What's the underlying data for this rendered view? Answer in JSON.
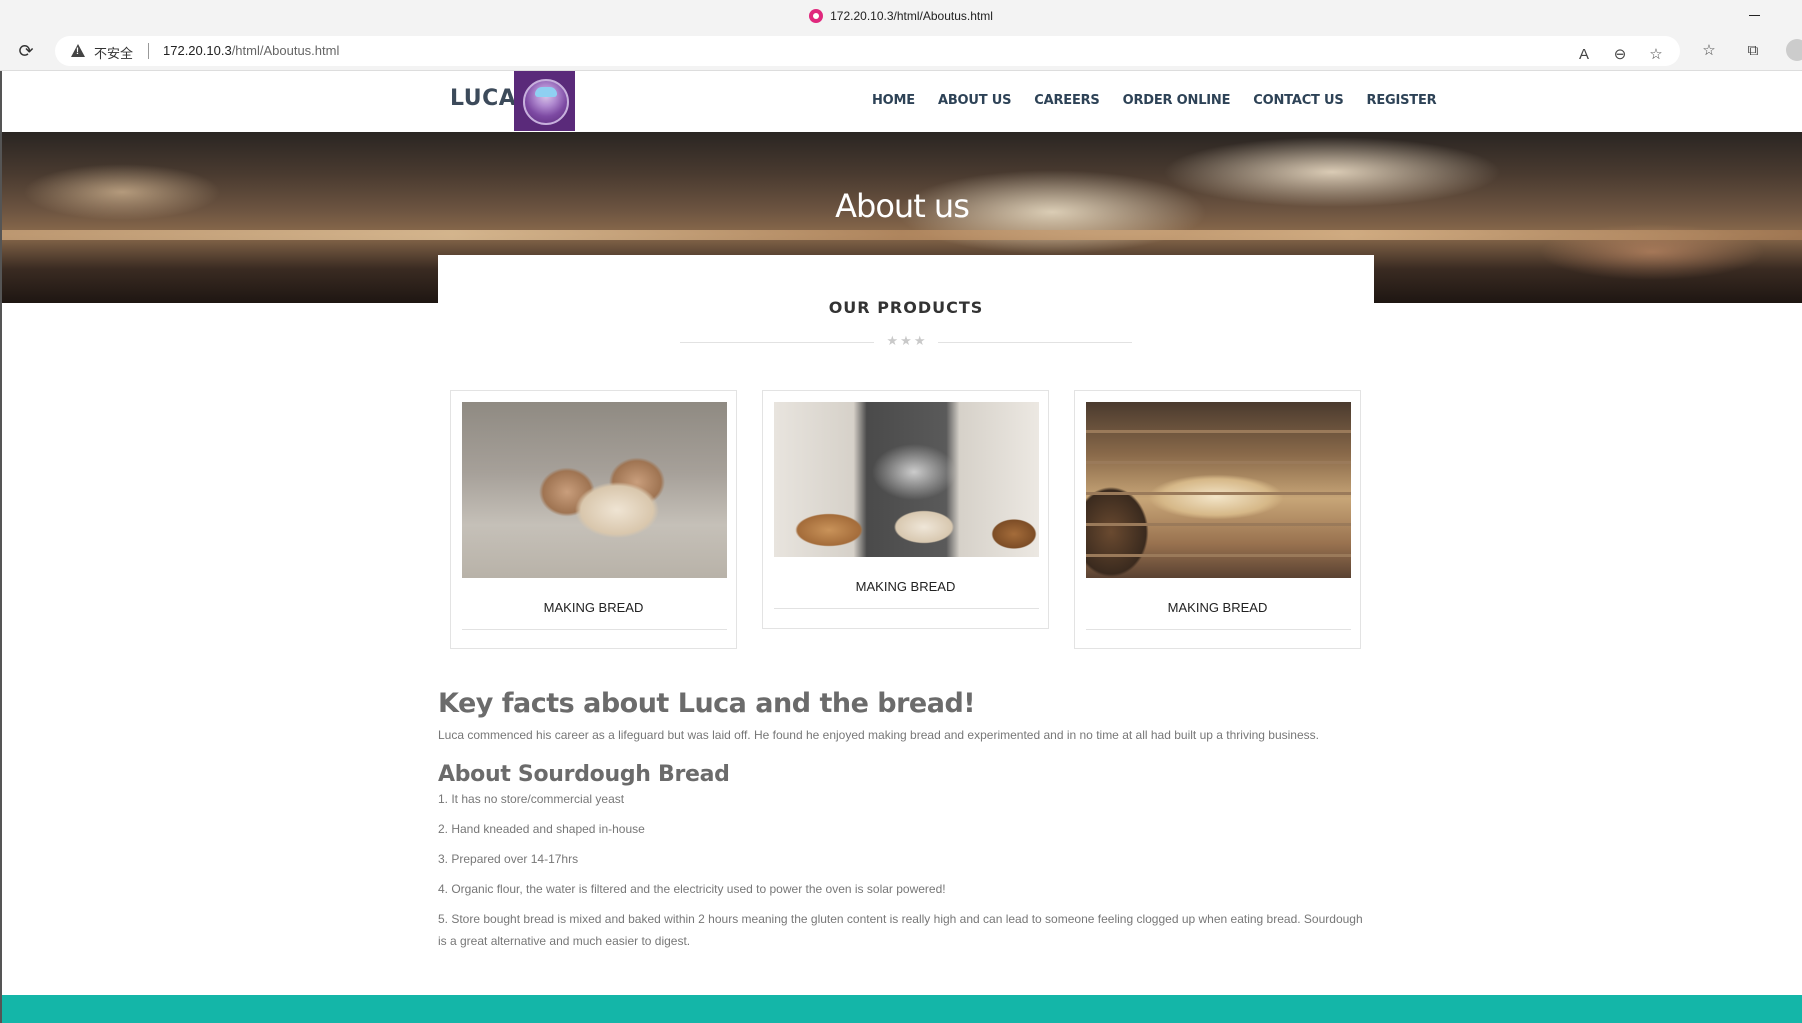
{
  "browser": {
    "tab_title": "172.20.10.3/html/Aboutus.html",
    "security_label": "不安全",
    "url_host": "172.20.10.3",
    "url_path": "/html/Aboutus.html"
  },
  "navbar": {
    "brand": "LUCA",
    "menu": [
      "HOME",
      "ABOUT US",
      "CAREERS",
      "ORDER ONLINE",
      "CONTACT US",
      "REGISTER"
    ]
  },
  "hero": {
    "title": "About us"
  },
  "products": {
    "heading": "OUR PRODUCTS",
    "stars": "★★★",
    "items": [
      {
        "caption": "MAKING BREAD"
      },
      {
        "caption": "MAKING BREAD"
      },
      {
        "caption": "MAKING BREAD"
      }
    ]
  },
  "facts": {
    "heading": "Key facts about Luca and the bread!",
    "body": "Luca commenced his career as a lifeguard but was laid off. He found he enjoyed making bread and experimented and in no time at all had built up a thriving business.",
    "subheading": "About Sourdough Bread",
    "list": [
      "1. It has no store/commercial yeast",
      "2. Hand kneaded and shaped in-house",
      "3. Prepared over 14-17hrs",
      "4. Organic flour, the water is filtered and the electricity used to power the oven is solar powered!",
      "5. Store bought bread is mixed and baked within 2 hours meaning the gluten content is really high and can lead to someone feeling clogged up when eating bread. Sourdough is a great alternative and much easier to digest."
    ]
  },
  "colors": {
    "footer_accent": "#14b6a8",
    "nav_text": "#2d4256",
    "logo_bg": "#5a2a7a"
  }
}
